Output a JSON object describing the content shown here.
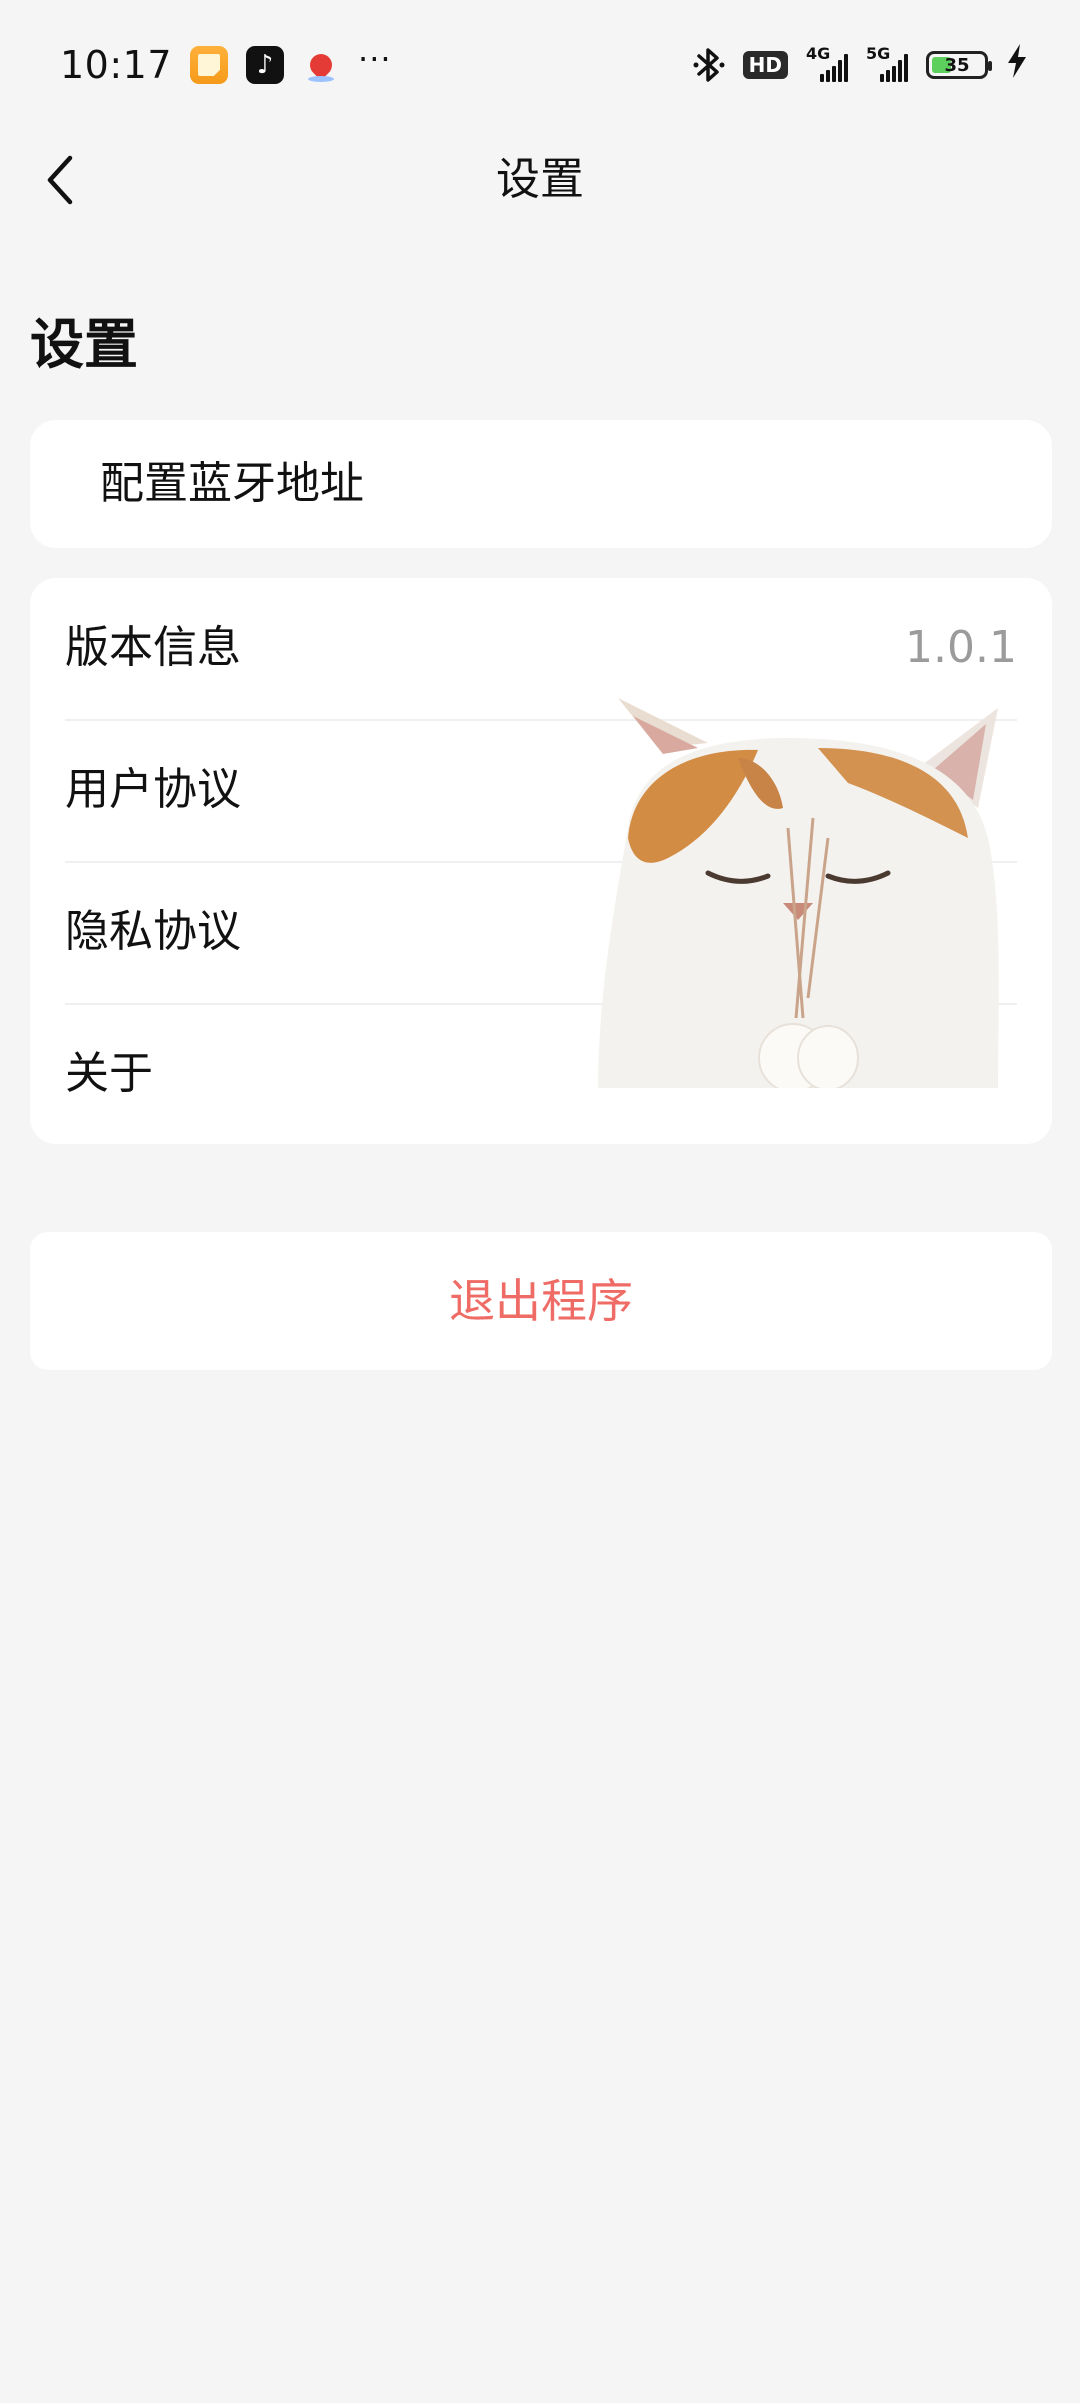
{
  "status_bar": {
    "time": "10:17",
    "more": "···",
    "hd": "HD",
    "network_1": "4G",
    "network_2": "5G",
    "battery": "35",
    "icons": [
      "notes-icon",
      "tiktok-icon",
      "maps-icon",
      "bluetooth-icon",
      "signal-icon",
      "battery-icon",
      "charging-icon"
    ]
  },
  "nav": {
    "title": "设置",
    "back_icon": "chevron-left-icon"
  },
  "page": {
    "heading": "设置"
  },
  "bluetooth_card": {
    "label": "配置蓝牙地址"
  },
  "settings_list": [
    {
      "label": "版本信息",
      "value": "1.0.1"
    },
    {
      "label": "用户协议",
      "value": ""
    },
    {
      "label": "隐私协议",
      "value": ""
    },
    {
      "label": "关于",
      "value": ""
    }
  ],
  "exit": {
    "label": "退出程序",
    "color": "#ef6b66"
  },
  "colors": {
    "background": "#f5f5f5",
    "card": "#ffffff",
    "secondary_text": "#9b9b9b"
  }
}
